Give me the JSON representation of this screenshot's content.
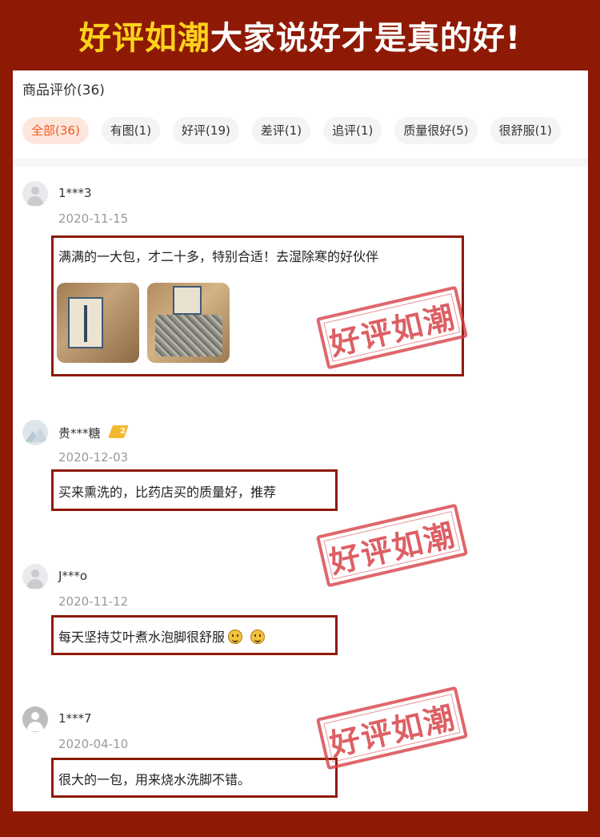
{
  "banner": {
    "highlight": "好评如潮",
    "rest": "大家说好才是真的好!"
  },
  "section": {
    "title": "商品评价(36)"
  },
  "tabs": [
    {
      "label": "全部(36)",
      "active": true
    },
    {
      "label": "有图(1)",
      "active": false
    },
    {
      "label": "好评(19)",
      "active": false
    },
    {
      "label": "差评(1)",
      "active": false
    },
    {
      "label": "追评(1)",
      "active": false
    },
    {
      "label": "质量很好(5)",
      "active": false
    },
    {
      "label": "很舒服(1)",
      "active": false
    }
  ],
  "reviews": [
    {
      "user": "1***3",
      "date": "2020-11-15",
      "text": "满满的一大包，才二十多，特别合适！去湿除寒的好伙伴",
      "avatar": "default-avatar-icon"
    },
    {
      "user": "贵***糖",
      "date": "2020-12-03",
      "text": "买来熏洗的，比药店买的质量好，推荐",
      "avatar": "mountain-avatar-icon",
      "badge": "2"
    },
    {
      "user": "J***o",
      "date": "2020-11-12",
      "text": "每天坚持艾叶煮水泡脚很舒服",
      "avatar": "default-avatar-icon"
    },
    {
      "user": "1***7",
      "date": "2020-04-10",
      "text": "很大的一包，用来烧水洗脚不错。",
      "avatar": "dark-avatar-icon"
    }
  ],
  "stamp": {
    "text": "好评如潮"
  },
  "colors": {
    "background": "#8e1a05",
    "highlight": "#ffd21c",
    "active_tab_text": "#f25a1f",
    "stamp": "#d63c42"
  }
}
